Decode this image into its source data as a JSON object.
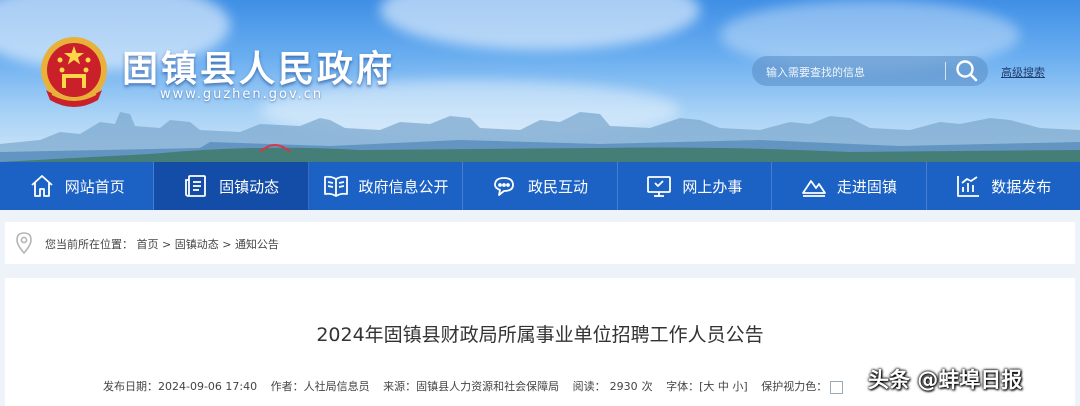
{
  "header": {
    "site_name": "固镇县人民政府",
    "site_url": "www.guzhen.gov.cn",
    "search_placeholder": "输入需要查找的信息",
    "advanced_search_label": "高级搜索"
  },
  "nav": {
    "items": [
      {
        "label": "网站首页",
        "icon": "home-icon",
        "active": false
      },
      {
        "label": "固镇动态",
        "icon": "news-icon",
        "active": true
      },
      {
        "label": "政府信息公开",
        "icon": "book-icon",
        "active": false
      },
      {
        "label": "政民互动",
        "icon": "chat-icon",
        "active": false
      },
      {
        "label": "网上办事",
        "icon": "monitor-icon",
        "active": false
      },
      {
        "label": "走进固镇",
        "icon": "mountain-icon",
        "active": false
      },
      {
        "label": "数据发布",
        "icon": "chart-icon",
        "active": false
      }
    ]
  },
  "breadcrumb": {
    "prefix": "您当前所在位置：",
    "items": [
      "首页",
      "固镇动态",
      "通知公告"
    ],
    "separator": ">"
  },
  "article": {
    "title": "2024年固镇县财政局所属事业单位招聘工作人员公告",
    "meta": {
      "publish_label": "发布日期：",
      "publish_date": "2024-09-06 17:40",
      "author_label": "作者：",
      "author": "人社局信息员",
      "source_label": "来源：",
      "source": "固镇县人力资源和社会保障局",
      "reads_label": "阅读：",
      "reads": "2930",
      "reads_unit": "次",
      "fontsize_label": "字体：",
      "fontsize_options": [
        "大",
        "中",
        "小"
      ],
      "eye_label": "保护视力色："
    }
  },
  "watermark": "头条 @蚌埠日报",
  "colors": {
    "nav_bg": "#1c62c5",
    "nav_active": "#134da7",
    "page_bg": "#eef3f9",
    "title_text": "#333333"
  }
}
